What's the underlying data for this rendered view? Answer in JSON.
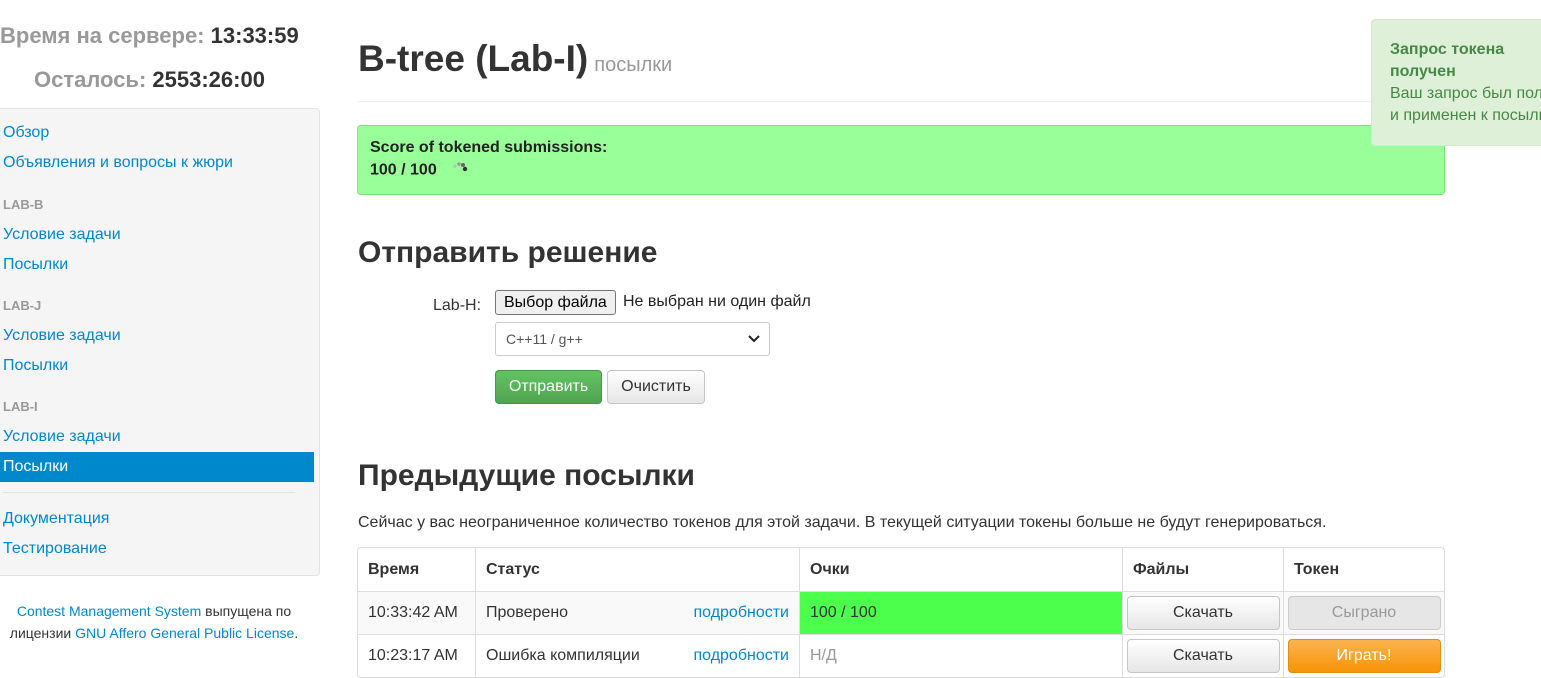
{
  "clock": {
    "server_label": "Время на сервере:",
    "server_value": "13:33:59",
    "remaining_label": "Осталось:",
    "remaining_value": "2553:26:00"
  },
  "sidebar": {
    "overview": "Обзор",
    "announcements": "Объявления и вопросы к жюри",
    "sections": [
      {
        "header": "LAB-B",
        "statement": "Условие задачи",
        "submissions": "Посылки"
      },
      {
        "header": "LAB-J",
        "statement": "Условие задачи",
        "submissions": "Посылки"
      },
      {
        "header": "LAB-I",
        "statement": "Условие задачи",
        "submissions": "Посылки"
      }
    ],
    "documentation": "Документация",
    "testing": "Тестирование"
  },
  "footer": {
    "cms_link": "Contest Management System",
    "text1": " выпущена по лицензии ",
    "license_link": "GNU Affero General Public License",
    "text2": "."
  },
  "page": {
    "title": "B-tree (Lab-I)",
    "subtitle": "посылки"
  },
  "score": {
    "label": "Score of tokened submissions:",
    "value": "100 / 100"
  },
  "submit": {
    "heading": "Отправить решение",
    "file_label": "Lab-H:",
    "file_button": "Выбор файла",
    "file_status": "Не выбран ни один файл",
    "language": "C++11 / g++",
    "send": "Отправить",
    "clear": "Очистить"
  },
  "previous": {
    "heading": "Предыдущие посылки",
    "token_info": "Сейчас у вас неограниченное количество токенов для этой задачи. В текущей ситуации токены больше не будут генерироваться.",
    "columns": [
      "Время",
      "Статус",
      "Очки",
      "Файлы",
      "Токен"
    ],
    "rows": [
      {
        "time": "10:33:42 AM",
        "status": "Проверено",
        "details": "подробности",
        "score": "100 / 100",
        "files": "Скачать",
        "token": "Сыграно"
      },
      {
        "time": "10:23:17 AM",
        "status": "Ошибка компиляции",
        "details": "подробности",
        "score": "Н/Д",
        "files": "Скачать",
        "token": "Играть!"
      }
    ]
  },
  "notification": {
    "title": "Запрос токена получен",
    "line1": "Ваш запрос был получен",
    "line2": "и применен к посылке."
  },
  "colors": {
    "link": "#0088cc",
    "score_bg": "#99ff99",
    "score_full": "#4cff4c",
    "send_button": "#51a351",
    "play_button": "#f89406",
    "notification_bg": "#dff0d8",
    "notification_text": "#468847"
  }
}
